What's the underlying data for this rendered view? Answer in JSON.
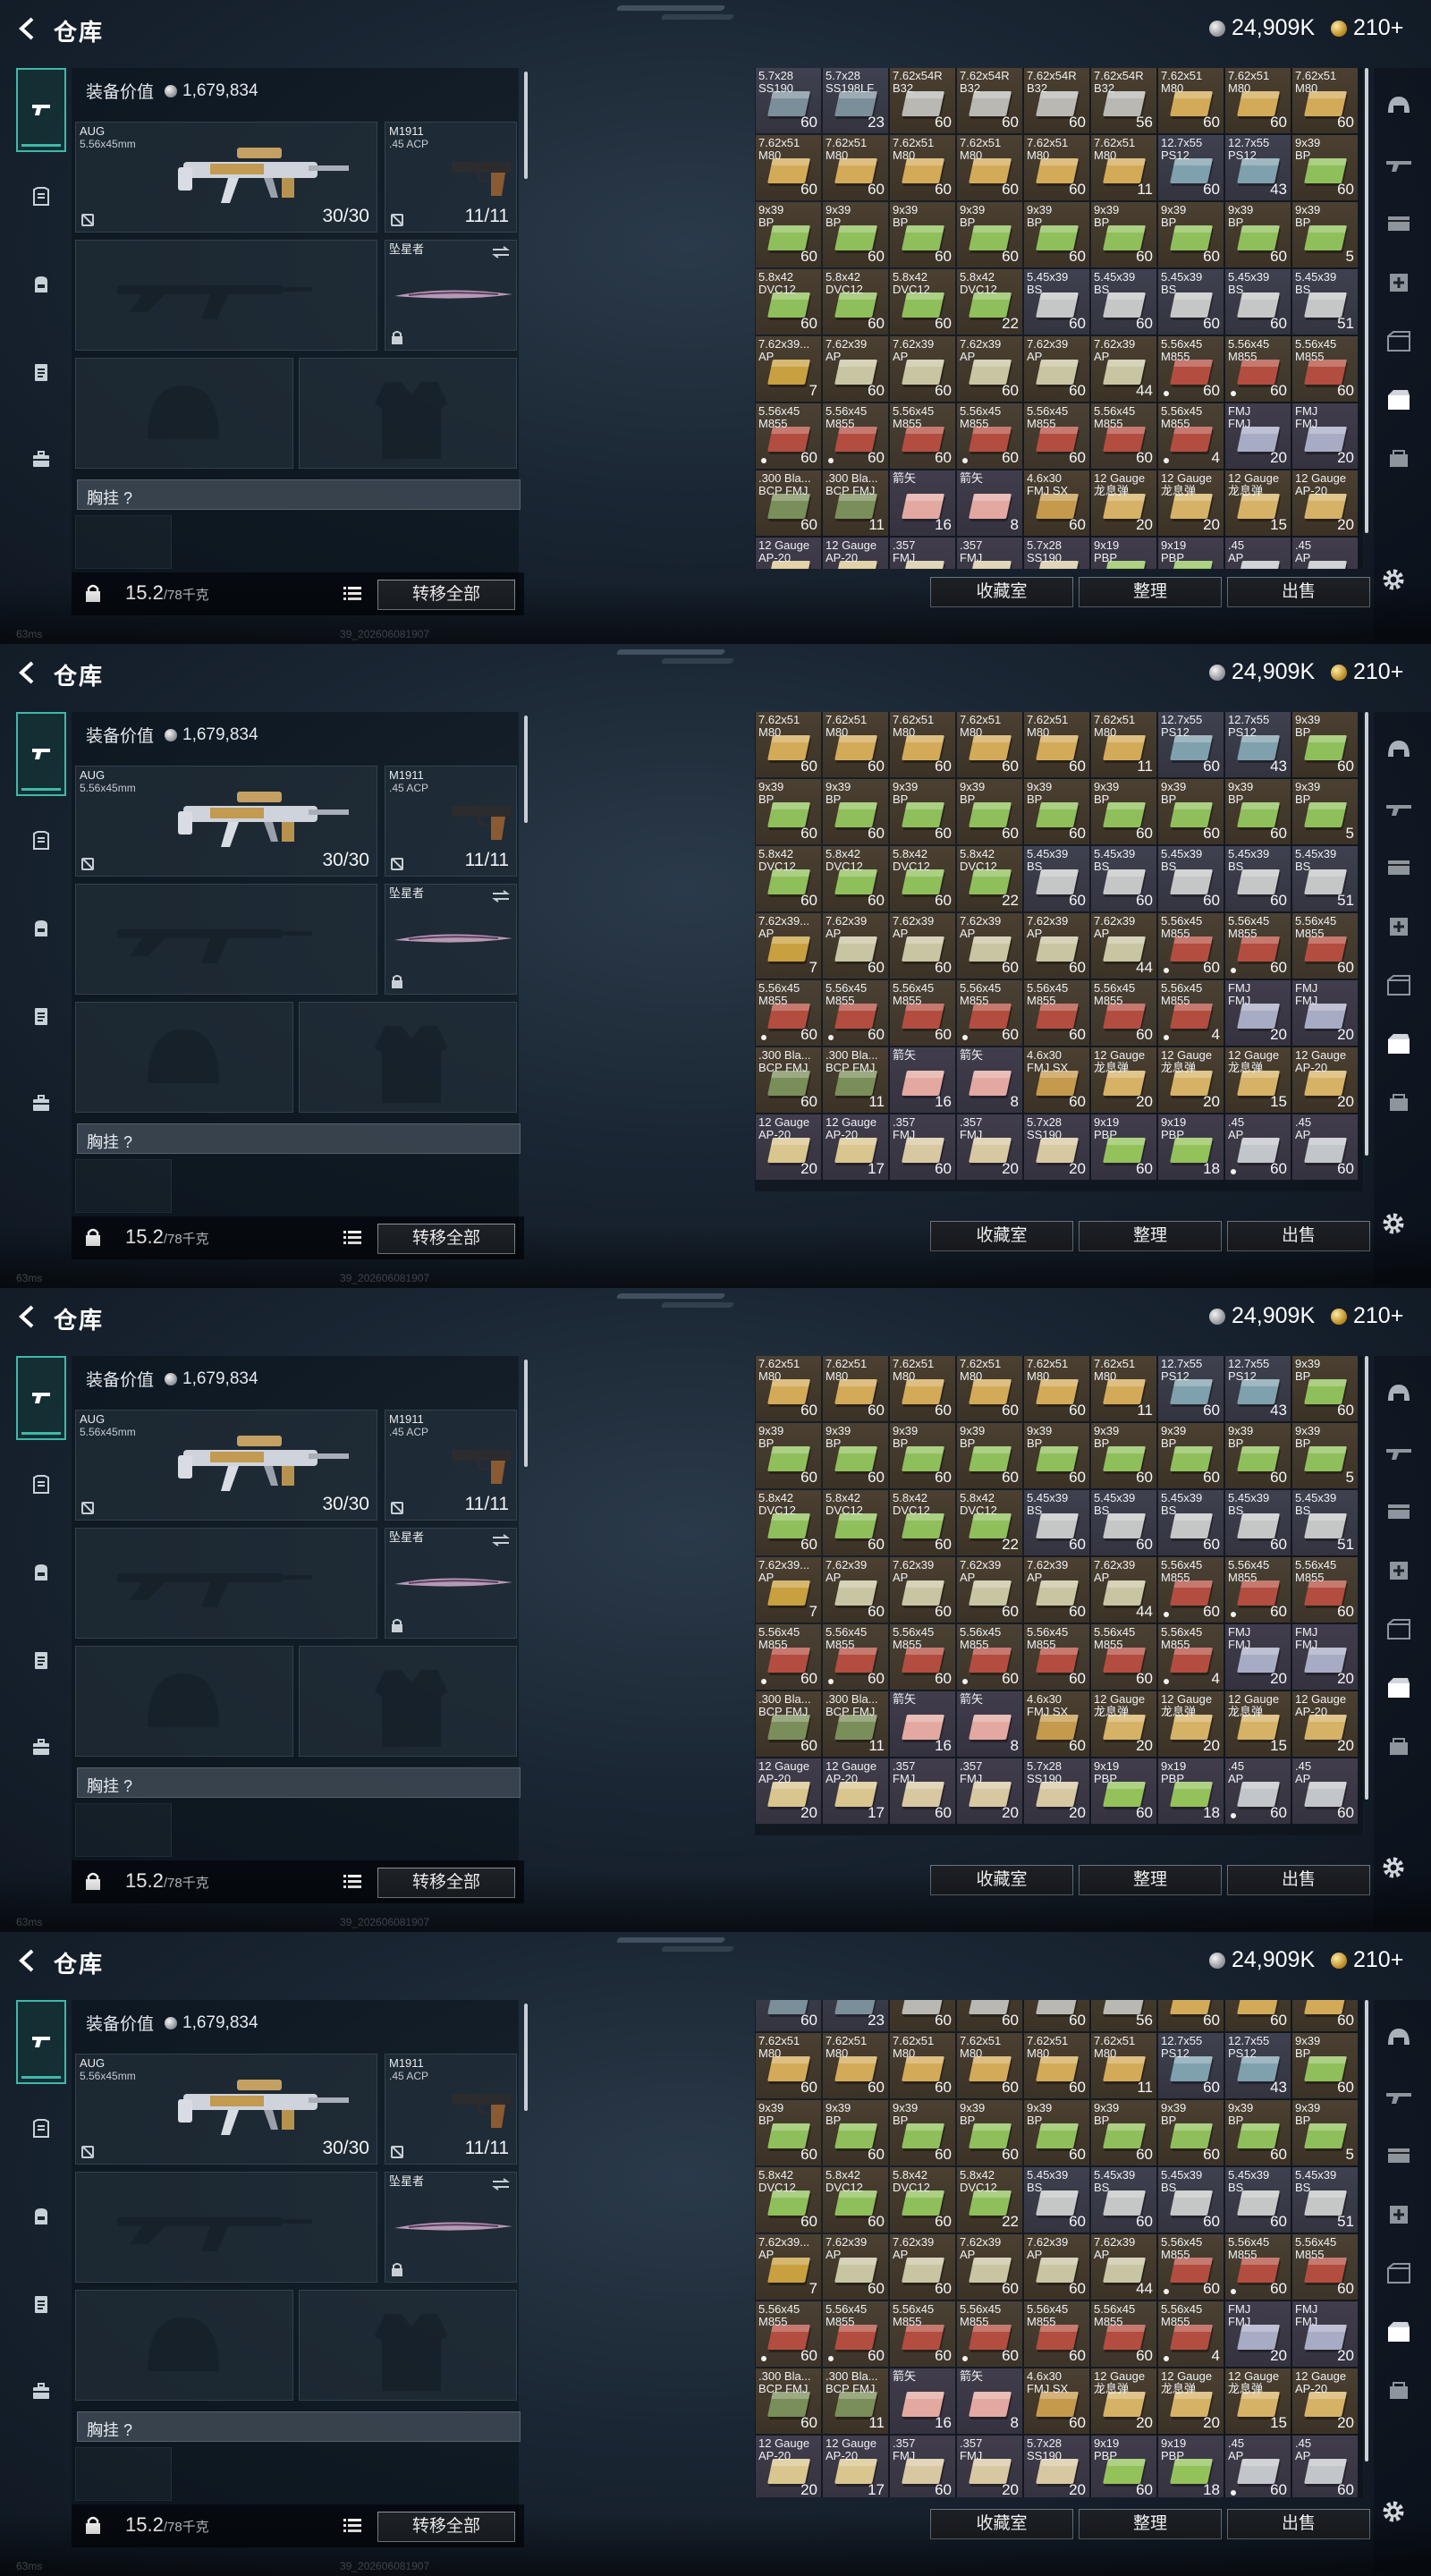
{
  "header": {
    "title": "仓库",
    "silver_amount": "24,909K",
    "gold_amount": "210+"
  },
  "equipment": {
    "value_label": "装备价值",
    "value_amount": "1,679,834",
    "primary": {
      "name": "AUG",
      "caliber": "5.56x45mm",
      "ammo": "30/30"
    },
    "secondary": {
      "name": "M1911",
      "caliber": ".45 ACP",
      "ammo": "11/11"
    },
    "melee": {
      "name": "坠星者"
    },
    "chest_rig_label": "胸挂 ?",
    "weight_current": "15.2",
    "weight_max": "/78千克",
    "transfer_all": "转移全部"
  },
  "inventory": {
    "buttons": {
      "vault": "收藏室",
      "sort": "整理",
      "sell": "出售"
    },
    "items": [
      {
        "name": "5.7x28\nSS190",
        "qty": "60",
        "tone": "v",
        "box": "#7b8f9b"
      },
      {
        "name": "5.7x28\nSS198LF",
        "qty": "23",
        "tone": "v",
        "box": "#7b8f9b"
      },
      {
        "name": "7.62x54R\nB32",
        "qty": "60",
        "tone": "s",
        "box": "#b9b8b3"
      },
      {
        "name": "7.62x54R\nB32",
        "qty": "60",
        "tone": "s",
        "box": "#b9b8b3"
      },
      {
        "name": "7.62x54R\nB32",
        "qty": "60",
        "tone": "s",
        "box": "#b9b8b3"
      },
      {
        "name": "7.62x54R\nB32",
        "qty": "56",
        "tone": "s",
        "box": "#b9b8b3"
      },
      {
        "name": "7.62x51\nM80",
        "qty": "60",
        "tone": "s",
        "box": "#d3aa58"
      },
      {
        "name": "7.62x51\nM80",
        "qty": "60",
        "tone": "s",
        "box": "#d3aa58"
      },
      {
        "name": "7.62x51\nM80",
        "qty": "60",
        "tone": "s",
        "box": "#d3aa58"
      },
      {
        "name": "7.62x51\nM80",
        "qty": "60",
        "tone": "s",
        "box": "#d3aa58"
      },
      {
        "name": "7.62x51\nM80",
        "qty": "60",
        "tone": "s",
        "box": "#d3aa58"
      },
      {
        "name": "7.62x51\nM80",
        "qty": "60",
        "tone": "s",
        "box": "#d3aa58"
      },
      {
        "name": "7.62x51\nM80",
        "qty": "60",
        "tone": "s",
        "box": "#d3aa58"
      },
      {
        "name": "7.62x51\nM80",
        "qty": "60",
        "tone": "s",
        "box": "#d3aa58"
      },
      {
        "name": "7.62x51\nM80",
        "qty": "11",
        "tone": "s",
        "box": "#d3aa58"
      },
      {
        "name": "12.7x55\nPS12",
        "qty": "60",
        "tone": "v",
        "box": "#7fa0ad"
      },
      {
        "name": "12.7x55\nPS12",
        "qty": "43",
        "tone": "v",
        "box": "#7fa0ad"
      },
      {
        "name": "9x39\nBP",
        "qty": "60",
        "tone": "s",
        "box": "#8fbf5a"
      },
      {
        "name": "9x39\nBP",
        "qty": "60",
        "tone": "s",
        "box": "#8fbf5a"
      },
      {
        "name": "9x39\nBP",
        "qty": "60",
        "tone": "s",
        "box": "#8fbf5a"
      },
      {
        "name": "9x39\nBP",
        "qty": "60",
        "tone": "s",
        "box": "#8fbf5a"
      },
      {
        "name": "9x39\nBP",
        "qty": "60",
        "tone": "s",
        "box": "#8fbf5a"
      },
      {
        "name": "9x39\nBP",
        "qty": "60",
        "tone": "s",
        "box": "#8fbf5a"
      },
      {
        "name": "9x39\nBP",
        "qty": "60",
        "tone": "s",
        "box": "#8fbf5a"
      },
      {
        "name": "9x39\nBP",
        "qty": "60",
        "tone": "s",
        "box": "#8fbf5a"
      },
      {
        "name": "9x39\nBP",
        "qty": "60",
        "tone": "s",
        "box": "#8fbf5a"
      },
      {
        "name": "9x39\nBP",
        "qty": "5",
        "tone": "s",
        "box": "#8fbf5a"
      },
      {
        "name": "5.8x42\nDVC12",
        "qty": "60",
        "tone": "s",
        "box": "#8fbf5a"
      },
      {
        "name": "5.8x42\nDVC12",
        "qty": "60",
        "tone": "s",
        "box": "#8fbf5a"
      },
      {
        "name": "5.8x42\nDVC12",
        "qty": "60",
        "tone": "s",
        "box": "#8fbf5a"
      },
      {
        "name": "5.8x42\nDVC12",
        "qty": "22",
        "tone": "s",
        "box": "#8fbf5a"
      },
      {
        "name": "5.45x39\nBS",
        "qty": "60",
        "tone": "v",
        "box": "#c5c7c6"
      },
      {
        "name": "5.45x39\nBS",
        "qty": "60",
        "tone": "v",
        "box": "#c5c7c6"
      },
      {
        "name": "5.45x39\nBS",
        "qty": "60",
        "tone": "v",
        "box": "#c5c7c6"
      },
      {
        "name": "5.45x39\nBS",
        "qty": "60",
        "tone": "v",
        "box": "#c5c7c6"
      },
      {
        "name": "5.45x39\nBS",
        "qty": "51",
        "tone": "v",
        "box": "#c5c7c6"
      },
      {
        "name": "7.62x39...\nAP",
        "qty": "7",
        "tone": "s",
        "box": "#c9a040"
      },
      {
        "name": "7.62x39\nAP",
        "qty": "60",
        "tone": "s",
        "box": "#c8c5a2"
      },
      {
        "name": "7.62x39\nAP",
        "qty": "60",
        "tone": "s",
        "box": "#c8c5a2"
      },
      {
        "name": "7.62x39\nAP",
        "qty": "60",
        "tone": "s",
        "box": "#c8c5a2"
      },
      {
        "name": "7.62x39\nAP",
        "qty": "60",
        "tone": "s",
        "box": "#c8c5a2"
      },
      {
        "name": "7.62x39\nAP",
        "qty": "44",
        "tone": "s",
        "box": "#c8c5a2"
      },
      {
        "name": "5.56x45\nM855",
        "qty": "60",
        "tone": "r",
        "box": "#b34d3f",
        "dot": true
      },
      {
        "name": "5.56x45\nM855",
        "qty": "60",
        "tone": "r",
        "box": "#b34d3f",
        "dot": true
      },
      {
        "name": "5.56x45\nM855",
        "qty": "60",
        "tone": "r",
        "box": "#b34d3f"
      },
      {
        "name": "5.56x45\nM855",
        "qty": "60",
        "tone": "r",
        "box": "#b34d3f",
        "dot": true
      },
      {
        "name": "5.56x45\nM855",
        "qty": "60",
        "tone": "r",
        "box": "#b34d3f",
        "dot": true
      },
      {
        "name": "5.56x45\nM855",
        "qty": "60",
        "tone": "r",
        "box": "#b34d3f"
      },
      {
        "name": "5.56x45\nM855",
        "qty": "60",
        "tone": "r",
        "box": "#b34d3f",
        "dot": true
      },
      {
        "name": "5.56x45\nM855",
        "qty": "60",
        "tone": "r",
        "box": "#b34d3f"
      },
      {
        "name": "5.56x45\nM855",
        "qty": "60",
        "tone": "r",
        "box": "#b34d3f"
      },
      {
        "name": "5.56x45\nM855",
        "qty": "4",
        "tone": "r",
        "box": "#b34d3f",
        "dot": true
      },
      {
        "name": "FMJ\nFMJ",
        "qty": "20",
        "tone": "p",
        "box": "#a8abc4"
      },
      {
        "name": "FMJ\nFMJ",
        "qty": "20",
        "tone": "p",
        "box": "#a8abc4"
      },
      {
        "name": ".300 Bla...\nBCP FMJ",
        "qty": "60",
        "tone": "s",
        "box": "#7a8e5a"
      },
      {
        "name": ".300 Bla...\nBCP FMJ",
        "qty": "11",
        "tone": "s",
        "box": "#7a8e5a"
      },
      {
        "name": "箭矢\n",
        "qty": "16",
        "tone": "p",
        "box": "#e3a9a1"
      },
      {
        "name": "箭矢\n",
        "qty": "8",
        "tone": "p",
        "box": "#e3a9a1"
      },
      {
        "name": "4.6x30\nFMJ SX",
        "qty": "60",
        "tone": "s",
        "box": "#c59a4d"
      },
      {
        "name": "12 Gauge\n龙息弹",
        "qty": "20",
        "tone": "s",
        "box": "#d6b266"
      },
      {
        "name": "12 Gauge\n龙息弹",
        "qty": "20",
        "tone": "s",
        "box": "#d6b266"
      },
      {
        "name": "12 Gauge\n龙息弹",
        "qty": "15",
        "tone": "s",
        "box": "#d6b266"
      },
      {
        "name": "12 Gauge\nAP-20",
        "qty": "20",
        "tone": "s",
        "box": "#d6b266"
      },
      {
        "name": "12 Gauge\nAP-20",
        "qty": "20",
        "tone": "p",
        "box": "#d9c58e"
      },
      {
        "name": "12 Gauge\nAP-20",
        "qty": "17",
        "tone": "p",
        "box": "#d9c58e"
      },
      {
        "name": ".357\nFMJ",
        "qty": "60",
        "tone": "p",
        "box": "#d7c8a2"
      },
      {
        "name": ".357\nFMJ",
        "qty": "20",
        "tone": "p",
        "box": "#d7c8a2"
      },
      {
        "name": "5.7x28\nSS190",
        "qty": "20",
        "tone": "p",
        "box": "#d7c8a2"
      },
      {
        "name": "9x19\nPBP",
        "qty": "60",
        "tone": "p",
        "box": "#93c25a"
      },
      {
        "name": "9x19\nPBP",
        "qty": "18",
        "tone": "p",
        "box": "#93c25a"
      },
      {
        "name": ".45\nAP",
        "qty": "60",
        "tone": "p",
        "box": "#c2c5c9",
        "dot": true
      },
      {
        "name": ".45\nAP",
        "qty": "60",
        "tone": "p",
        "box": "#c2c5c9"
      }
    ]
  },
  "status_bar": {
    "ping": "63ms",
    "build": "39_202606081907"
  }
}
